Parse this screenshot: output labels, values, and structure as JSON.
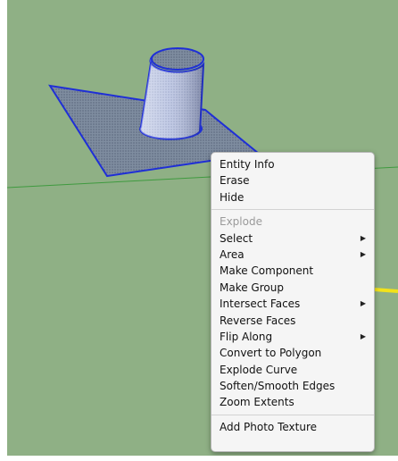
{
  "menu": {
    "groups": [
      [
        {
          "label": "Entity Info",
          "enabled": true,
          "submenu": false
        },
        {
          "label": "Erase",
          "enabled": true,
          "submenu": false
        },
        {
          "label": "Hide",
          "enabled": true,
          "submenu": false
        }
      ],
      [
        {
          "label": "Explode",
          "enabled": false,
          "submenu": false
        },
        {
          "label": "Select",
          "enabled": true,
          "submenu": true
        },
        {
          "label": "Area",
          "enabled": true,
          "submenu": true
        },
        {
          "label": "Make Component",
          "enabled": true,
          "submenu": false
        },
        {
          "label": "Make Group",
          "enabled": true,
          "submenu": false
        },
        {
          "label": "Intersect Faces",
          "enabled": true,
          "submenu": true
        },
        {
          "label": "Reverse Faces",
          "enabled": true,
          "submenu": false
        },
        {
          "label": "Flip Along",
          "enabled": true,
          "submenu": true
        },
        {
          "label": "Convert to Polygon",
          "enabled": true,
          "submenu": false
        },
        {
          "label": "Explode Curve",
          "enabled": true,
          "submenu": false
        },
        {
          "label": "Soften/Smooth Edges",
          "enabled": true,
          "submenu": false
        },
        {
          "label": "Zoom Extents",
          "enabled": true,
          "submenu": false
        }
      ],
      [
        {
          "label": "Add Photo Texture",
          "enabled": true,
          "submenu": false
        }
      ]
    ],
    "submenu_arrow": "▶"
  },
  "colors": {
    "ground": "#8fb085",
    "axis_green": "#3f9a3f",
    "selection_blue": "#1f2fd6",
    "callout_arrow": "#f2e21a",
    "menu_bg": "#f5f5f5"
  }
}
